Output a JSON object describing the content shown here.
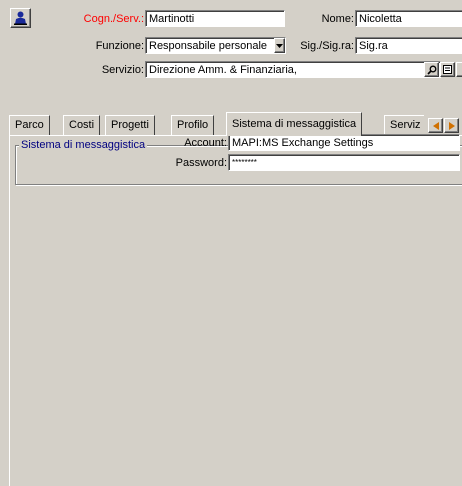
{
  "header": {
    "surname_label": "Cogn./Serv.:",
    "surname_value": "Martinotti",
    "name_label": "Nome:",
    "name_value": "Nicoletta",
    "function_label": "Funzione:",
    "function_value": "Responsabile personale",
    "title_label": "Sig./Sig.ra:",
    "title_value": "Sig.ra",
    "service_label": "Servizio:",
    "service_value": "Direzione Amm. & Finanziaria,",
    "accent_color": "#ff0000"
  },
  "tabs": [
    {
      "label": "Parco"
    },
    {
      "label": "Costi"
    },
    {
      "label": "Progetti"
    },
    {
      "label": "Profilo"
    },
    {
      "label": "Sistema di messaggistica"
    },
    {
      "label": "Serviz"
    }
  ],
  "messaging": {
    "group_title": "Sistema di messaggistica",
    "account_label": "Account:",
    "account_value": "MAPI:MS Exchange Settings",
    "password_label": "Password:",
    "password_value": "********"
  }
}
